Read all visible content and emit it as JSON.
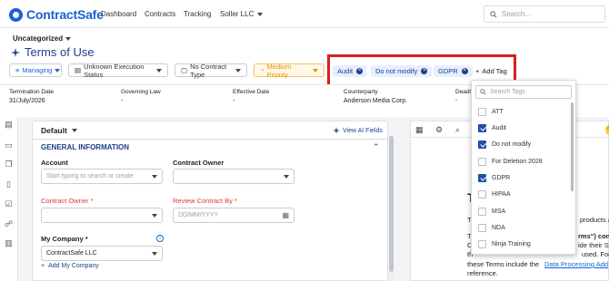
{
  "app": {
    "brand": "ContractSafe"
  },
  "nav": {
    "items": [
      "Dashboard",
      "Contracts",
      "Tracking",
      "Soller LLC"
    ],
    "search_placeholder": "Search..."
  },
  "header": {
    "folder": "Uncategorized",
    "title": "Terms of Use"
  },
  "filters": [
    {
      "label": "Managing",
      "style": "blue"
    },
    {
      "label": "Unknown Execution Status",
      "style": "plain"
    },
    {
      "label": "No Contract Type",
      "style": "plain"
    },
    {
      "label": "Medium Priority",
      "style": "orange"
    }
  ],
  "tags": [
    "Audit",
    "Do not modify",
    "GDPR"
  ],
  "add_tag_label": "Add Tag",
  "info": [
    {
      "label": "Termination Date",
      "value": "31/July/2026"
    },
    {
      "label": "Governing Law",
      "value": "-"
    },
    {
      "label": "Effective Date",
      "value": "-"
    },
    {
      "label": "Counterparty",
      "value": "Anderson Media Corp."
    },
    {
      "label": "Deadlin",
      "value": "-"
    }
  ],
  "form": {
    "view_name": "Default",
    "ai_fields_label": "View AI Fields",
    "section_title": "GENERAL INFORMATION",
    "account_label": "Account",
    "account_placeholder": "Start typing to search or create",
    "owner_label": "Contract Owner",
    "owner_req_label": "Contract Owner *",
    "review_label": "Review Contract By *",
    "review_placeholder": "DD/MM/YYYY",
    "company_label": "My Company *",
    "company_value": "ContractSafe LLC",
    "add_company_label": "Add My Company"
  },
  "doc_text": {
    "big_letter": "T",
    "lines": [
      "products and",
      "rms\") cont",
      "ide their Se",
      "used. For",
      "these Terms include the",
      "Data Processing Add",
      "reference."
    ],
    "left_fragments": [
      "T",
      "T",
      "C",
      "th"
    ]
  },
  "dropdown": {
    "search_placeholder": "Search Tags",
    "items": [
      {
        "label": "ATT",
        "checked": false
      },
      {
        "label": "Audit",
        "checked": true
      },
      {
        "label": "Do not modify",
        "checked": true
      },
      {
        "label": "For Deletion 2028",
        "checked": false
      },
      {
        "label": "GDPR",
        "checked": true
      },
      {
        "label": "HIPAA",
        "checked": false
      },
      {
        "label": "MSA",
        "checked": false
      },
      {
        "label": "NDA",
        "checked": false
      },
      {
        "label": "Ninja Training",
        "checked": false
      }
    ]
  },
  "colors": {
    "brand": "#1763d1",
    "title": "#1f3e8a",
    "required": "#d63a3a",
    "priority": "#e69100",
    "highlight": "#d62020"
  }
}
